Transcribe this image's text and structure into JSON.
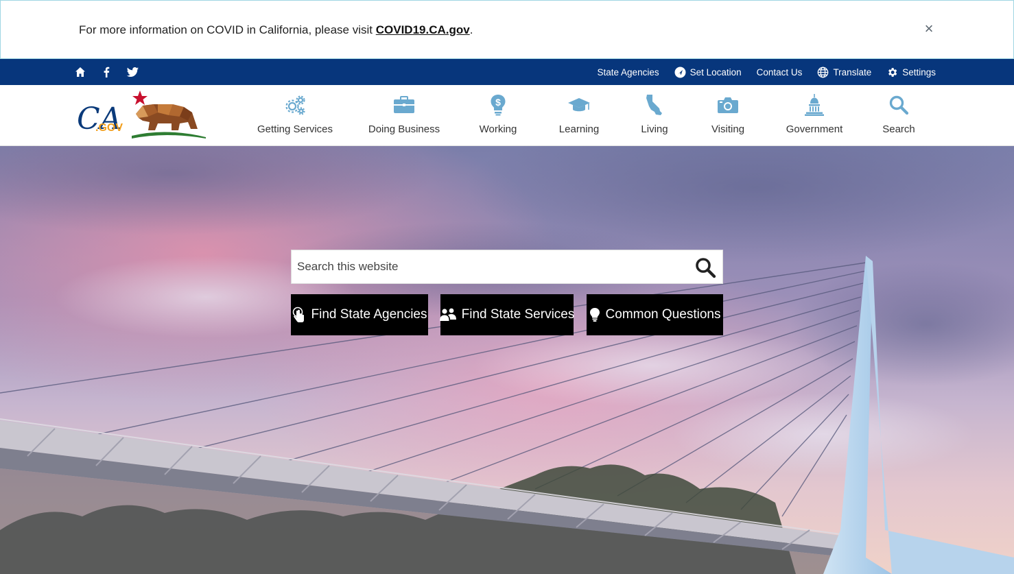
{
  "alert": {
    "text_prefix": "For more information on COVID in California, please visit ",
    "link_text": "COVID19.CA.gov",
    "text_suffix": ".",
    "close_glyph": "×"
  },
  "utility": {
    "social_icons": [
      "home-icon",
      "facebook-icon",
      "twitter-icon"
    ],
    "links": [
      {
        "label": "State Agencies",
        "icon": null
      },
      {
        "label": "Set Location",
        "icon": "location-icon"
      },
      {
        "label": "Contact Us",
        "icon": null
      },
      {
        "label": "Translate",
        "icon": "globe-icon"
      },
      {
        "label": "Settings",
        "icon": "gear-icon"
      }
    ]
  },
  "logo": {
    "text_ca": "CA",
    "text_gov": ".GOV"
  },
  "nav": {
    "items": [
      {
        "label": "Getting Services",
        "icon": "gears-icon"
      },
      {
        "label": "Doing Business",
        "icon": "briefcase-icon"
      },
      {
        "label": "Working",
        "icon": "dollar-bulb-icon"
      },
      {
        "label": "Learning",
        "icon": "graduation-cap-icon"
      },
      {
        "label": "Living",
        "icon": "california-state-icon"
      },
      {
        "label": "Visiting",
        "icon": "camera-icon"
      },
      {
        "label": "Government",
        "icon": "capitol-icon"
      },
      {
        "label": "Search",
        "icon": "search-icon"
      }
    ]
  },
  "hero": {
    "search_placeholder": "Search this website",
    "buttons": [
      {
        "label": "Find State Agencies",
        "icon": "hand-pointer-icon"
      },
      {
        "label": "Find State Services",
        "icon": "people-icon"
      },
      {
        "label": "Common Questions",
        "icon": "lightbulb-icon"
      }
    ]
  },
  "colors": {
    "utility_bar": "#07367c",
    "nav_icon": "#6aa9cf",
    "cta_bg": "#000000"
  }
}
